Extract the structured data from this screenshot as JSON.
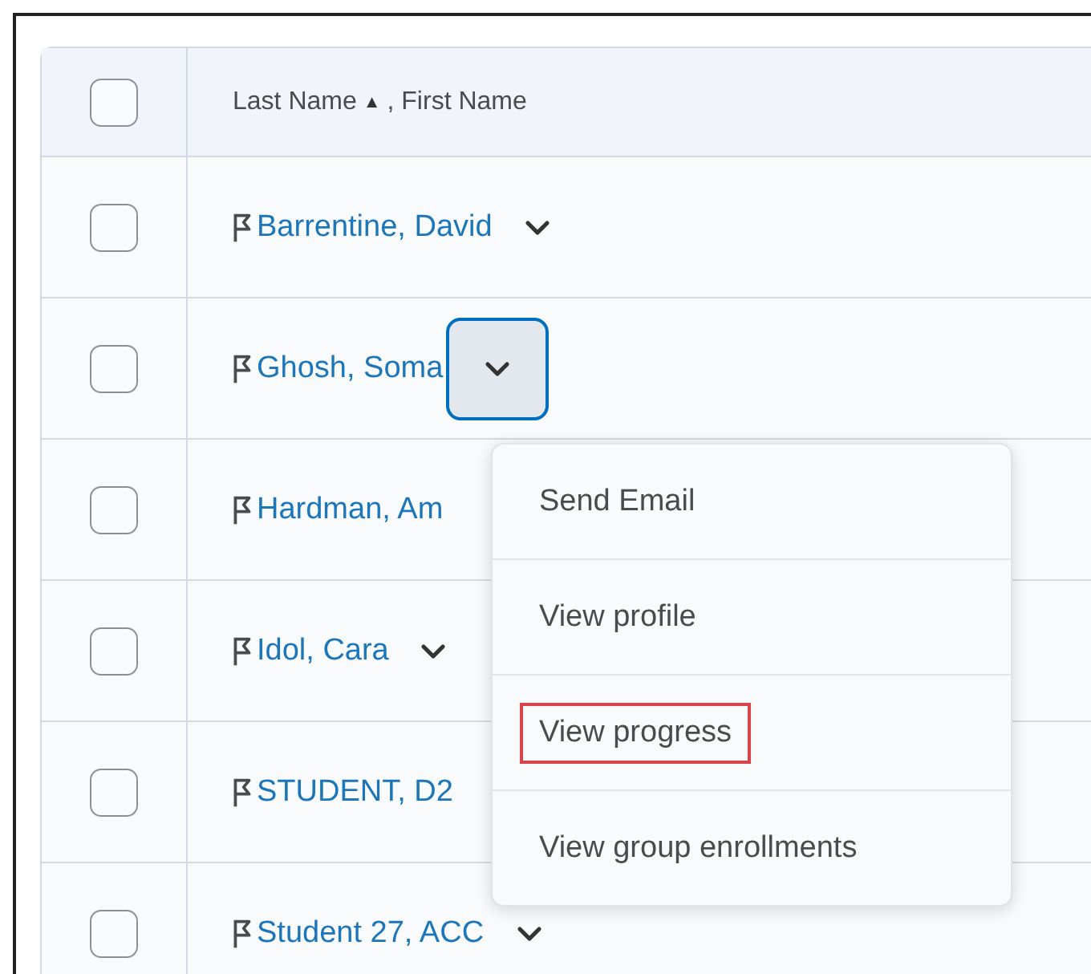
{
  "table": {
    "select_all": {
      "checked": false
    },
    "header": {
      "sort_column": "Last Name",
      "sort_icon": "▲",
      "rest": ", First Name"
    },
    "rows": [
      {
        "name": "Barrentine, David",
        "checked": false,
        "menu_button": true,
        "menu_open": false
      },
      {
        "name": "Ghosh, Soma",
        "checked": false,
        "menu_button": true,
        "menu_open": true
      },
      {
        "name": "Hardman, Am",
        "checked": false,
        "menu_button": false,
        "menu_open": false
      },
      {
        "name": "Idol, Cara",
        "checked": false,
        "menu_button": true,
        "menu_open": false
      },
      {
        "name": "STUDENT, D2",
        "checked": false,
        "menu_button": false,
        "menu_open": false
      },
      {
        "name": "Student 27, ACC",
        "checked": false,
        "menu_button": true,
        "menu_open": false
      }
    ]
  },
  "menu": {
    "items": [
      {
        "label": "Send Email",
        "highlighted": false
      },
      {
        "label": "View profile",
        "highlighted": false
      },
      {
        "label": "View progress",
        "highlighted": true
      },
      {
        "label": "View group enrollments",
        "highlighted": false
      }
    ]
  }
}
